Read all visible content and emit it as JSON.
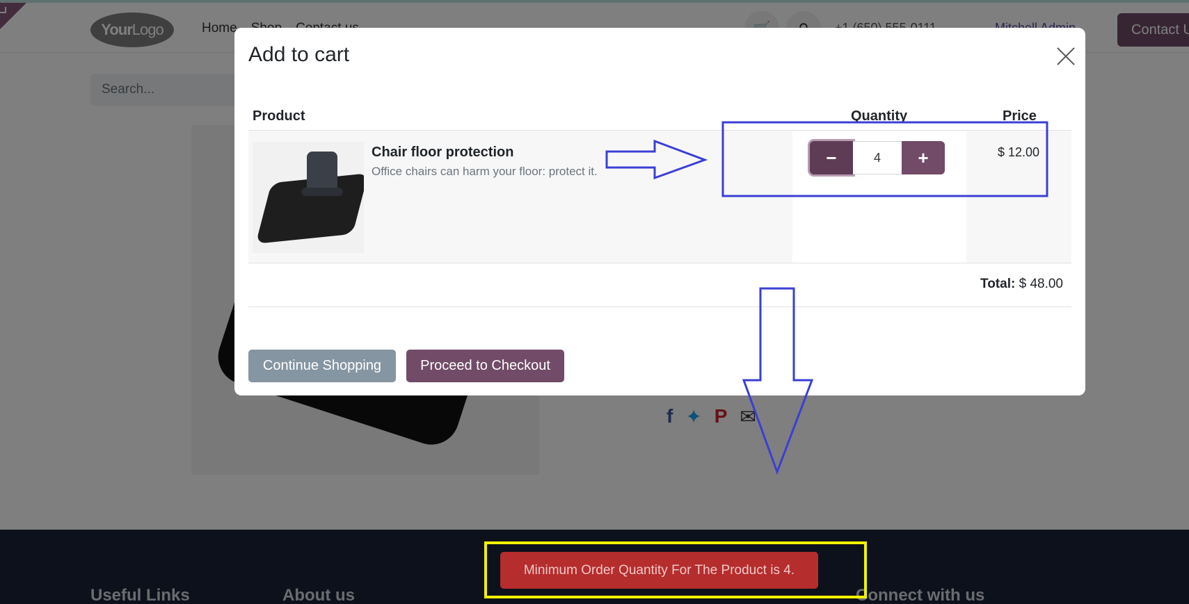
{
  "header": {
    "logo_text_bold": "Your",
    "logo_text": "Logo",
    "nav": [
      "Home",
      "Shop",
      "Contact us"
    ],
    "phone": "+1 (650) 555-0111",
    "user": "Mitchell Admin",
    "contact_button": "Contact Us"
  },
  "search": {
    "placeholder": "Search..."
  },
  "modal": {
    "title": "Add to cart",
    "columns": {
      "product": "Product",
      "quantity": "Quantity",
      "price": "Price"
    },
    "item": {
      "name": "Chair floor protection",
      "description": "Office chairs can harm your floor: protect it.",
      "quantity": "4",
      "price": "$ 12.00"
    },
    "total_label": "Total:",
    "total_value": "$ 48.00",
    "continue_label": "Continue Shopping",
    "checkout_label": "Proceed to Checkout"
  },
  "footer": {
    "headings": [
      "Useful Links",
      "About us",
      "Connect with us"
    ]
  },
  "toast": {
    "message": "Minimum Order Quantity For The Product is 4."
  },
  "icons": {
    "cart": "cart-icon",
    "search": "search-icon",
    "phone": "phone-icon",
    "close": "close-icon",
    "minus": "minus-icon",
    "plus": "plus-icon"
  },
  "colors": {
    "primary": "#714b67",
    "secondary": "#8595a2",
    "toast": "#b52d2d",
    "annotation_blue": "#3a3fd4",
    "annotation_yellow": "#f2f200"
  }
}
